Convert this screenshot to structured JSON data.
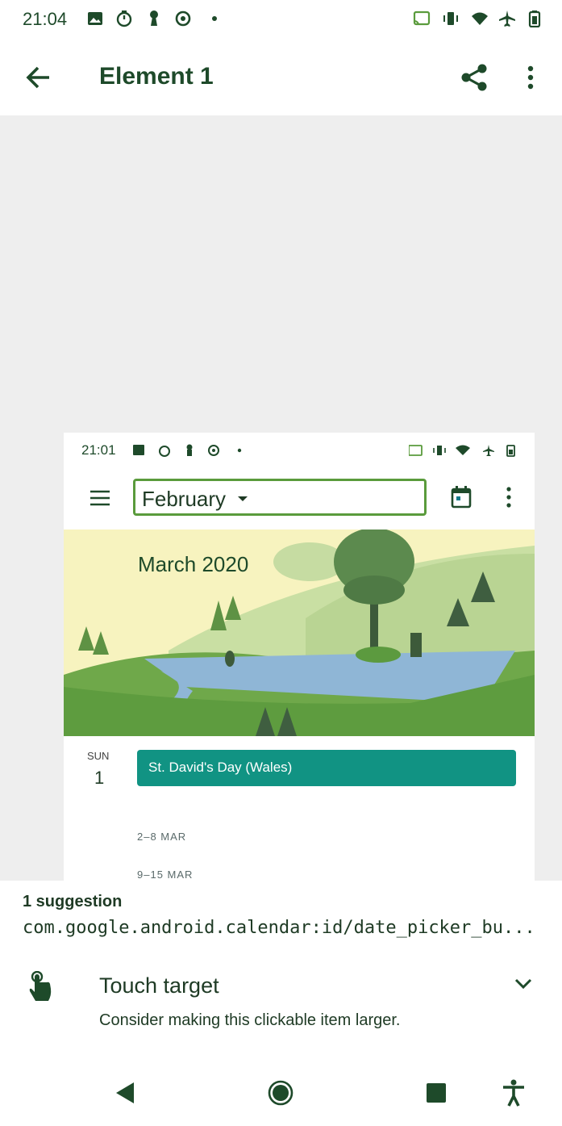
{
  "status_bar": {
    "time": "21:04",
    "icons": [
      "image-icon",
      "timer-icon",
      "keyhole-icon",
      "sync-icon",
      "dot-icon",
      "cast-icon",
      "vibrate-icon",
      "wifi-icon",
      "airplane-icon",
      "battery-icon"
    ]
  },
  "app_bar": {
    "title": "Element 1",
    "icons": [
      "back-arrow-icon",
      "share-icon",
      "more-vert-icon"
    ]
  },
  "screenshot": {
    "status_time": "21:01",
    "month_picker": "February",
    "banner_title": "March 2020",
    "day_label": "SUN",
    "day_number": "1",
    "event": "St. David's Day (Wales)",
    "weeks": [
      "2–8 MAR",
      "9–15 MAR"
    ]
  },
  "suggestions": {
    "count_label": "1 suggestion",
    "element_id": "com.google.android.calendar:id/date_picker_bu...",
    "item": {
      "title": "Touch target",
      "description": "Consider making this clickable item larger.",
      "icon": "touch-hand-icon"
    }
  },
  "nav_bar": {
    "icons": [
      "back-triangle-icon",
      "home-circle-icon",
      "recents-square-icon",
      "accessibility-icon"
    ]
  },
  "colors": {
    "accent": "#1e4a2a",
    "event": "#119383",
    "highlight": "#5a9b3c",
    "preview_bg": "#eeeeee"
  }
}
